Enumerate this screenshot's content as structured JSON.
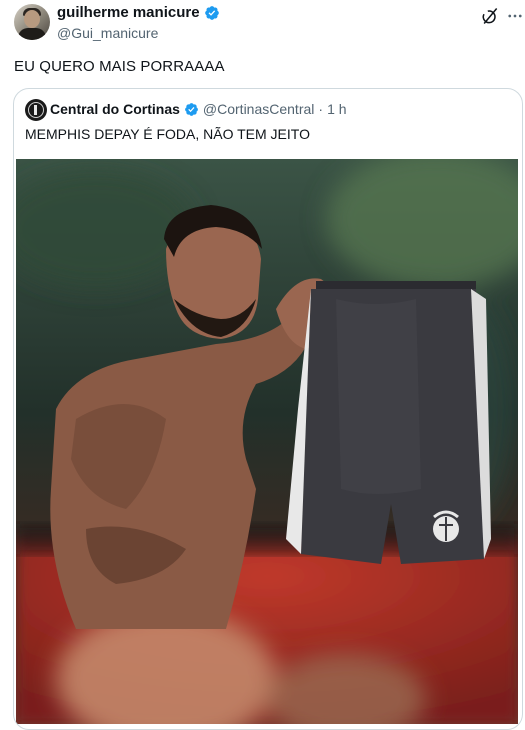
{
  "tweet": {
    "author": {
      "display_name": "guilherme manicure",
      "handle": "@Gui_manicure",
      "verified": true
    },
    "text": "EU QUERO MAIS PORRAAAA",
    "icons": [
      "grok-icon",
      "more-icon"
    ]
  },
  "quoted_tweet": {
    "author": {
      "display_name": "Central do Cortinas",
      "handle": "@CortinasCentral",
      "verified": true
    },
    "separator": "·",
    "time": "1 h",
    "text": "MEMPHIS DEPAY É FODA, NÃO TEM JEITO"
  },
  "colors": {
    "verified_blue": "#1d9bf0",
    "text_secondary": "#536471",
    "border": "#cfd9de"
  }
}
